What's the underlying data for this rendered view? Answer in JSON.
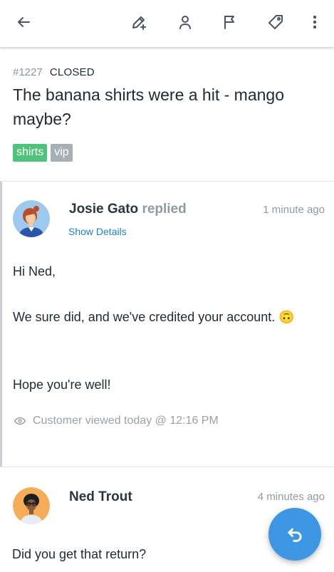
{
  "toolbar": {
    "icons": [
      "back-arrow-icon",
      "edit-note-icon",
      "assign-user-icon",
      "flag-icon",
      "tag-icon",
      "more-vertical-icon"
    ]
  },
  "ticket": {
    "number": "#1227",
    "status": "CLOSED",
    "subject": "The banana shirts were a hit - mango maybe?",
    "tags": [
      "shirts",
      "vip"
    ]
  },
  "threads": [
    {
      "author": "Josie Gato",
      "action": "replied",
      "time": "1 minute ago",
      "details_link": "Show Details",
      "body": [
        "Hi Ned,",
        "We sure did, and we've credited your account. 🙃",
        "Hope you're well!"
      ],
      "viewed": "Customer viewed today @ 12:16 PM"
    },
    {
      "author": "Ned Trout",
      "time": "4 minutes ago",
      "body": [
        "Did you get that return?"
      ]
    }
  ],
  "colors": {
    "accent": "#3d96e2",
    "tag_shirts": "#4fc27c",
    "tag_vip": "#a7b0b7",
    "link": "#1f80c8"
  }
}
